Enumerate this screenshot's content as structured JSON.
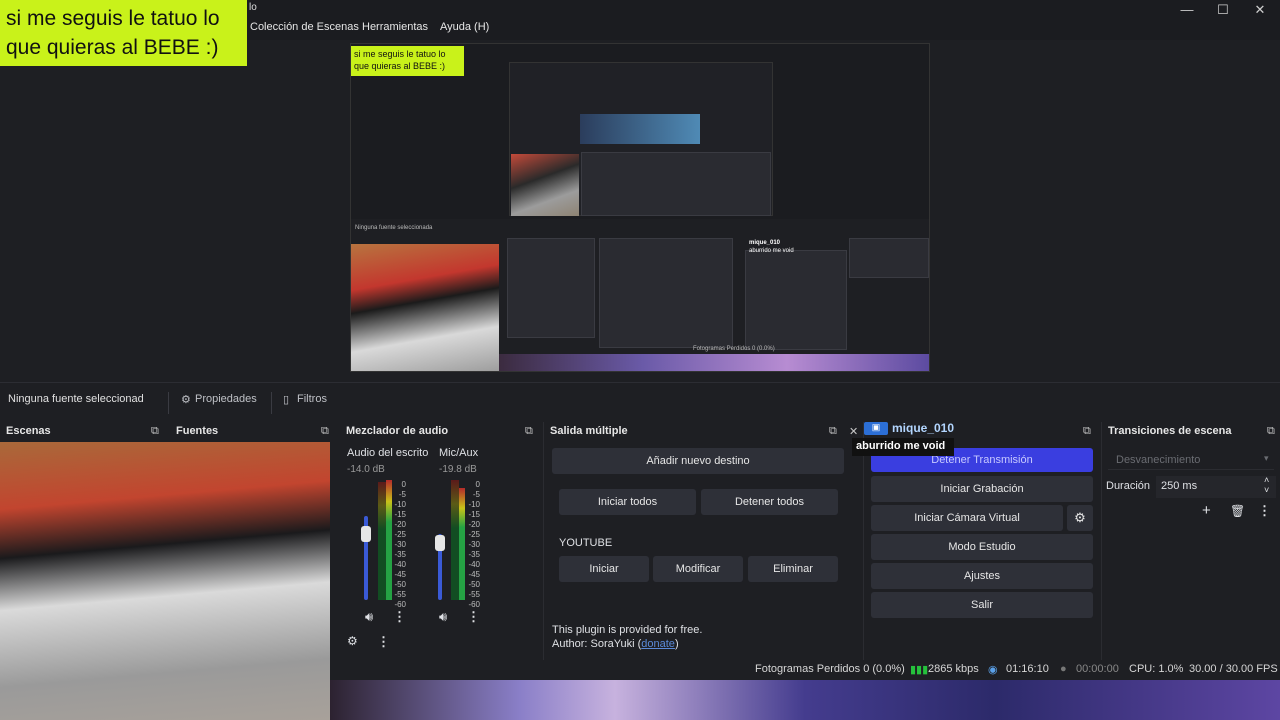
{
  "overlay": {
    "line1": "si me seguis le tatuo lo",
    "line2": "que quieras al BEBE :)"
  },
  "menu": {
    "item_collection": "Colección de Escenas",
    "item_tools": "Herramientas",
    "item_help": "Ayuda (H)",
    "title_fragment": "lo"
  },
  "window": {
    "min": "—",
    "max": "☐",
    "close": "✕"
  },
  "preview": {
    "nested_overlay_1": "si me seguis le tatuo lo",
    "nested_overlay_2": "que quieras al BEBE :)",
    "nested_chat_user": "mique_010",
    "nested_chat_msg": "aburrido me void",
    "nested_frames": "Fotogramas Perdidos 0 (0.0%)",
    "nested_no_source": "Ninguna fuente seleccionada"
  },
  "toolbar": {
    "no_source": "Ninguna fuente seleccionad",
    "properties": "Propiedades",
    "filters": "Filtros"
  },
  "docks": {
    "scenes": "Escenas",
    "sources": "Fuentes",
    "mixer": "Mezclador de audio",
    "multi": "Salida múltiple",
    "transitions": "Transiciones de escena"
  },
  "mixer": {
    "ch1": {
      "name": "Audio del escrito",
      "db": "-14.0 dB"
    },
    "ch2": {
      "name": "Mic/Aux",
      "db": "-19.8 dB"
    },
    "scale": [
      "0",
      "-5",
      "-10",
      "-15",
      "-20",
      "-25",
      "-30",
      "-35",
      "-40",
      "-45",
      "-50",
      "-55",
      "-60"
    ]
  },
  "multi": {
    "add": "Añadir nuevo destino",
    "start_all": "Iniciar todos",
    "stop_all": "Detener todos",
    "section": "YOUTUBE",
    "start": "Iniciar",
    "modify": "Modificar",
    "delete": "Eliminar",
    "free": "This plugin is provided for free.",
    "author_prefix": "Author: SoraYuki (",
    "author_link": "donate",
    "author_suffix": ")"
  },
  "chat": {
    "user": "mique_010",
    "message": "aburrido me void"
  },
  "controls": {
    "stop_stream": "Detener Transmisión",
    "start_rec": "Iniciar Grabación",
    "virtual_cam": "Iniciar Cámara Virtual",
    "studio": "Modo Estudio",
    "settings": "Ajustes",
    "exit": "Salir"
  },
  "transitions": {
    "type": "Desvanecimiento",
    "duration_label": "Duración",
    "duration_value": "250 ms"
  },
  "status": {
    "frames": "Fotogramas Perdidos 0 (0.0%)",
    "kbps": "2865 kbps",
    "stream_time": "01:16:10",
    "rec_time": "00:00:00",
    "cpu": "CPU: 1.0%",
    "fps": "30.00 / 30.00 FPS"
  },
  "colors": {
    "accent": "#3a3ee0",
    "overlay": "#c9f21a",
    "bg": "#1e1f23"
  }
}
